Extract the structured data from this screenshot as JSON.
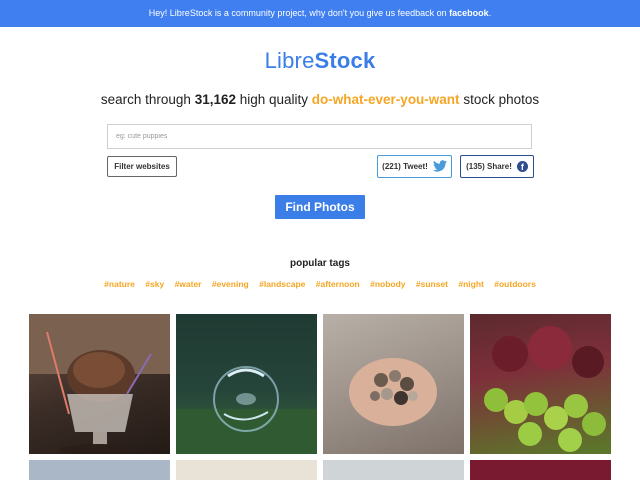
{
  "banner": {
    "text_prefix": "Hey! LibreStock is a community project, why don't you give us feedback on ",
    "link": "facebook",
    "text_suffix": "."
  },
  "logo": {
    "part1": "Libre",
    "part2": "Stock"
  },
  "tagline": {
    "prefix": "search through ",
    "count": "31,162",
    "middle": " high quality ",
    "highlight": "do-what-ever-you-want",
    "suffix": " stock photos"
  },
  "search": {
    "placeholder": "eg: cute puppies",
    "value": ""
  },
  "buttons": {
    "filter": "Filter websites",
    "tweet": "(221) Tweet!",
    "share": "(135) Share!",
    "find": "Find Photos"
  },
  "popular": {
    "title": "popular tags",
    "tags": [
      "#nature",
      "#sky",
      "#water",
      "#evening",
      "#landscape",
      "#afternoon",
      "#nobody",
      "#sunset",
      "#night",
      "#outdoors"
    ]
  },
  "colors": {
    "accent": "#3b7ee8",
    "banner": "#3f7ff0",
    "tag": "#f5a623",
    "twitter": "#4a9bd9",
    "facebook": "#2d4d8f"
  },
  "photos": [
    {
      "name": "ice-cream-photo"
    },
    {
      "name": "bubble-photo"
    },
    {
      "name": "pebbles-in-hands-photo"
    },
    {
      "name": "grapes-photo"
    }
  ]
}
